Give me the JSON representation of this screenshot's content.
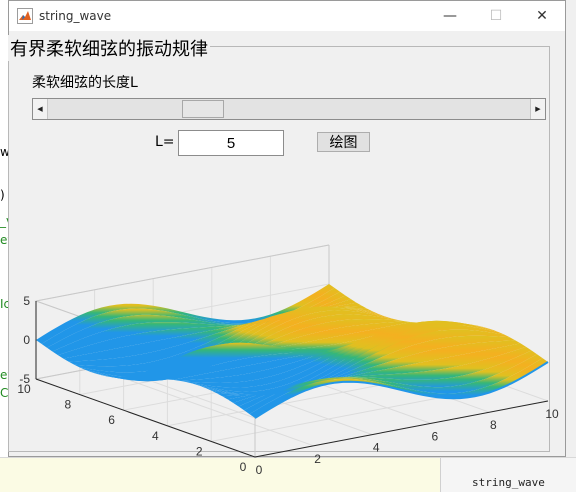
{
  "window": {
    "title": "string_wave",
    "controls": [
      "—",
      "☐",
      "✕"
    ]
  },
  "panel": {
    "title": "有界柔软细弦的振动规律"
  },
  "slider": {
    "label": "柔软细弦的长度L",
    "level_fraction": 0.25
  },
  "length_input": {
    "label": "L=",
    "value": "5"
  },
  "plot_button": {
    "label": "绘图"
  },
  "background": {
    "left_fragments": [
      "w",
      ")",
      "_v",
      "ev",
      "Ic",
      "ev",
      "C"
    ],
    "workspace_name": "string_wave"
  },
  "chart_data": {
    "type": "surface",
    "title": "",
    "x": {
      "label": "",
      "lim": [
        0,
        10
      ],
      "ticks": [
        0,
        2,
        4,
        6,
        8,
        10
      ]
    },
    "y": {
      "label": "",
      "lim": [
        0,
        10
      ],
      "ticks": [
        0,
        2,
        4,
        6,
        8,
        10
      ]
    },
    "z": {
      "label": "",
      "lim": [
        -5,
        5
      ],
      "ticks": [
        -5,
        0,
        5
      ]
    },
    "grid": true,
    "colormap": "parula",
    "colors": {
      "low": "#2196e8",
      "mid": "#35b778",
      "high": "#e0c020",
      "peak": "#f4b020"
    }
  }
}
